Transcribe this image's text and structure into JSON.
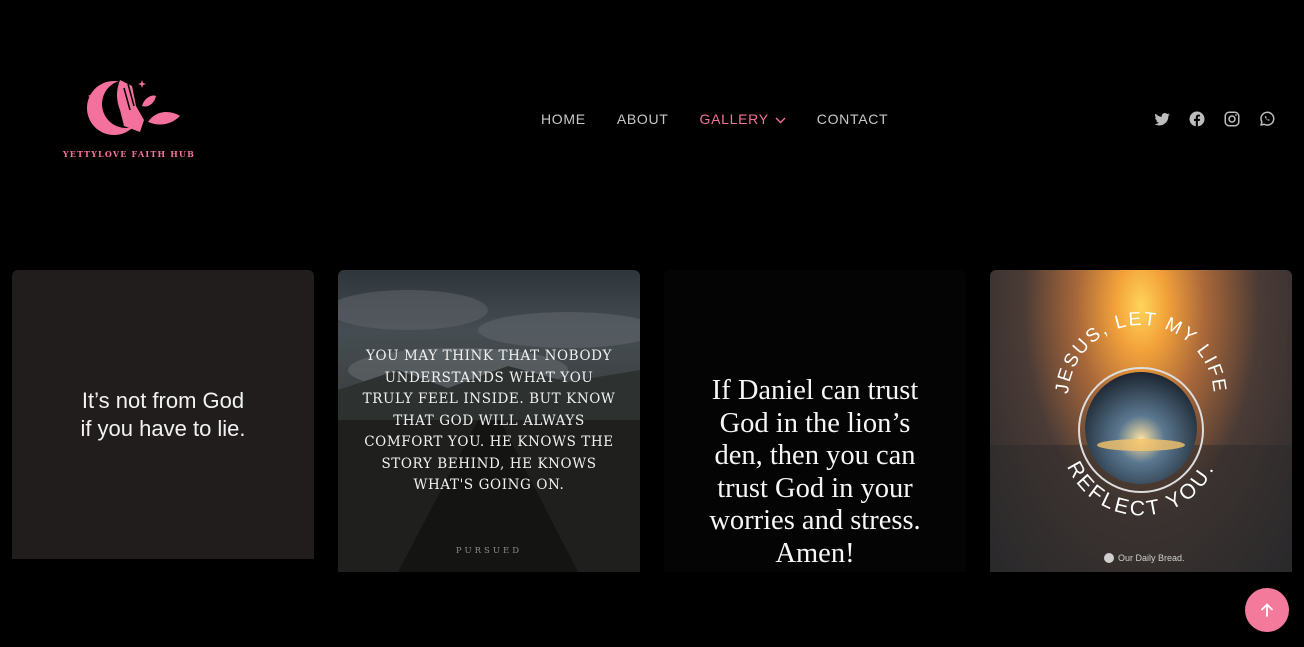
{
  "brand": {
    "name": "YETTYLOVE FAITH HUB",
    "accent": "#f4719e"
  },
  "nav": {
    "items": [
      {
        "label": "HOME"
      },
      {
        "label": "ABOUT"
      },
      {
        "label": "GALLERY",
        "active": true,
        "has_dropdown": true
      },
      {
        "label": "CONTACT"
      }
    ]
  },
  "socials": [
    "twitter-icon",
    "facebook-icon",
    "instagram-icon",
    "whatsapp-icon"
  ],
  "gallery": {
    "cards": [
      {
        "text": "It’s not from God\nif you have to lie."
      },
      {
        "text": "You may think that nobody understands what you truly feel inside. But know that God will always comfort you. He knows the story behind, He knows what's going on.",
        "brand": "PURSUED"
      },
      {
        "text": "If Daniel can trust God in the lion’s den, then you can trust God in your worries and stress. Amen!"
      },
      {
        "arc_top": "JESUS, LET MY LIFE",
        "arc_bottom": "REFLECT YOU.",
        "brand": "Our Daily Bread."
      }
    ]
  },
  "scroll_top": {
    "icon": "arrow-up-icon",
    "color": "#f47a9c"
  }
}
